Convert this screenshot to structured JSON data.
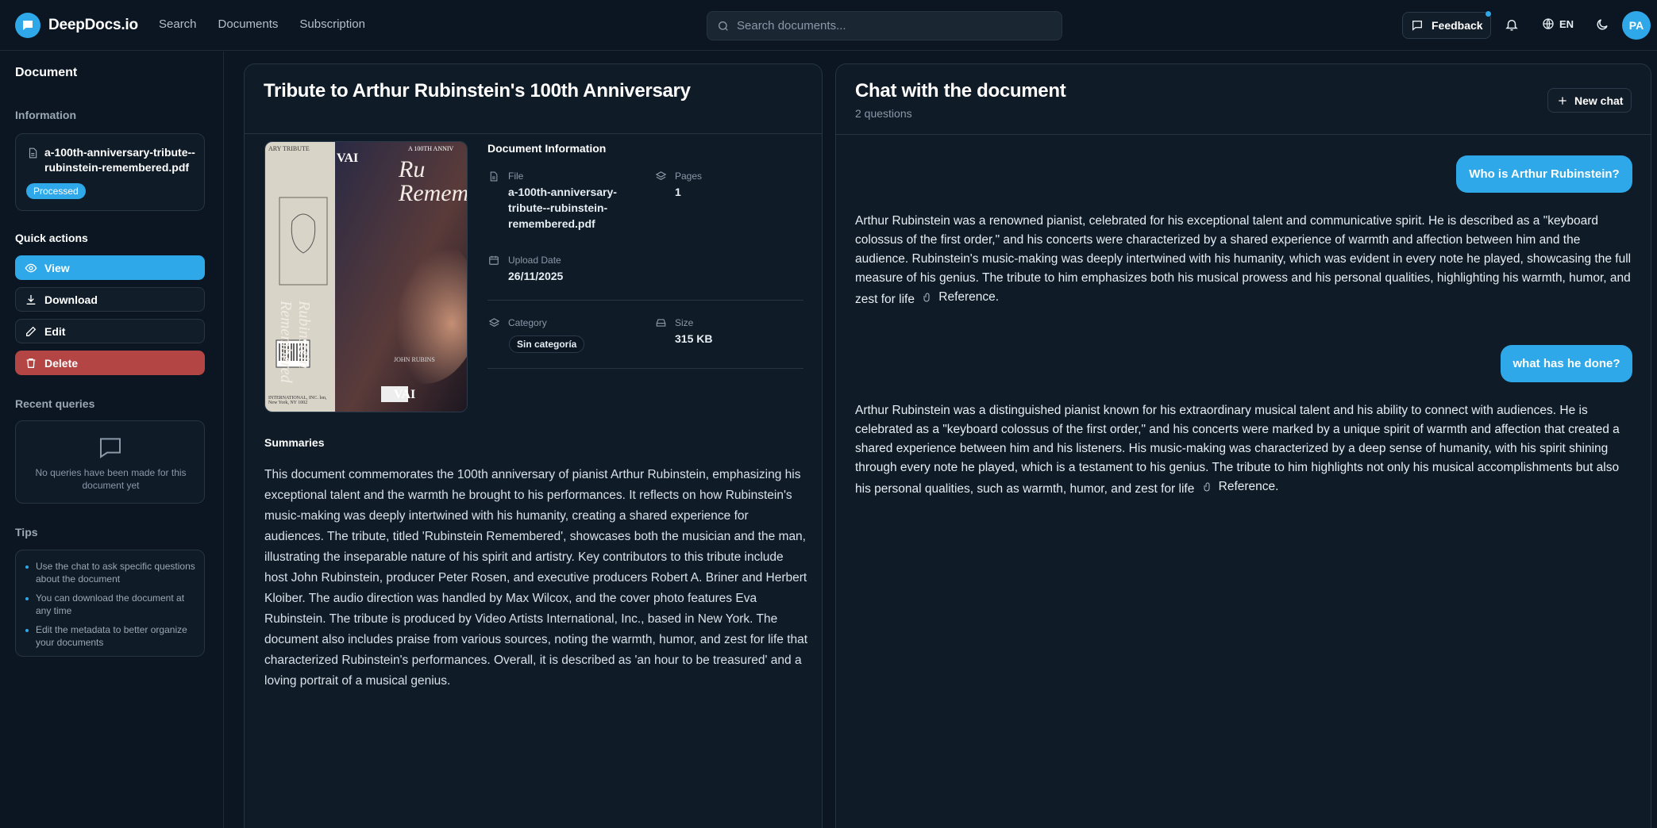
{
  "app": {
    "name": "DeepDocs.io"
  },
  "nav": {
    "search": "Search",
    "documents": "Documents",
    "subscription": "Subscription"
  },
  "topbar": {
    "search_placeholder": "Search documents...",
    "feedback": "Feedback",
    "lang": "EN",
    "avatar_initials": "PA"
  },
  "sidebar": {
    "title": "Document",
    "information_label": "Information",
    "filename": "a-100th-anniversary-tribute--rubinstein-remembered.pdf",
    "status": "Processed",
    "quick_actions_label": "Quick actions",
    "actions": {
      "view": "View",
      "download": "Download",
      "edit": "Edit",
      "delete": "Delete"
    },
    "recent_label": "Recent queries",
    "recent_empty": "No queries have been made for this document yet",
    "tips_label": "Tips",
    "tips": [
      "Use the chat to ask specific questions about the document",
      "You can download the document at any time",
      "Edit the metadata to better organize your documents"
    ]
  },
  "document": {
    "title": "Tribute to Arthur Rubinstein's 100th Anniversary",
    "info_heading": "Document Information",
    "file_label": "File",
    "file_value": "a-100th-anniversary-tribute--rubinstein-remembered.pdf",
    "pages_label": "Pages",
    "pages_value": "1",
    "upload_label": "Upload Date",
    "upload_value": "26/11/2025",
    "category_label": "Category",
    "category_value": "Sin categoría",
    "size_label": "Size",
    "size_value": "315 KB",
    "summaries_heading": "Summaries",
    "summary": "This document commemorates the 100th anniversary of pianist Arthur Rubinstein, emphasizing his exceptional talent and the warmth he brought to his performances. It reflects on how Rubinstein's music-making was deeply intertwined with his humanity, creating a shared experience for audiences. The tribute, titled 'Rubinstein Remembered', showcases both the musician and the man, illustrating the inseparable nature of his spirit and artistry. Key contributors to this tribute include host John Rubinstein, producer Peter Rosen, and executive producers Robert A. Briner and Herbert Kloiber. The audio direction was handled by Max Wilcox, and the cover photo features Eva Rubinstein. The tribute is produced by Video Artists International, Inc., based in New York. The document also includes praise from various sources, noting the warmth, humor, and zest for life that characterized Rubinstein's performances. Overall, it is described as 'an hour to be treasured' and a loving portrait of a musical genius.",
    "cover": {
      "top_left": "ARY TRIBUTE",
      "top_right": "A 100TH ANNIV",
      "vai": "VAI",
      "spine": "Rubinstein Remembered",
      "big": "Ru Remem",
      "john": "JOHN RUBINS",
      "bottom_left": "INTERNATIONAL, INC. lon, New York, NY 1002"
    }
  },
  "chat": {
    "title": "Chat with the document",
    "subtitle": "2 questions",
    "new_chat": "New chat",
    "q1": "Who is Arthur Rubinstein?",
    "a1": "Arthur Rubinstein was a renowned pianist, celebrated for his exceptional talent and communicative spirit. He is described as a \"keyboard colossus of the first order,\" and his concerts were characterized by a shared experience of warmth and affection between him and the audience. Rubinstein's music-making was deeply intertwined with his humanity, which was evident in every note he played, showcasing the full measure of his genius. The tribute to him emphasizes both his musical prowess and his personal qualities, highlighting his warmth, humor, and zest for life",
    "q2": "what has he done?",
    "a2": "Arthur Rubinstein was a distinguished pianist known for his extraordinary musical talent and his ability to connect with audiences. He is celebrated as a \"keyboard colossus of the first order,\" and his concerts were marked by a unique spirit of warmth and affection that created a shared experience between him and his listeners. His music-making was characterized by a deep sense of humanity, with his spirit shining through every note he played, which is a testament to his genius. The tribute to him highlights not only his musical accomplishments but also his personal qualities, such as warmth, humor, and zest for life",
    "reference_label": "Reference."
  },
  "colors": {
    "accent": "#2ea8e8",
    "danger": "#b44545",
    "background": "#0b1622",
    "panel": "#0f1b27"
  }
}
